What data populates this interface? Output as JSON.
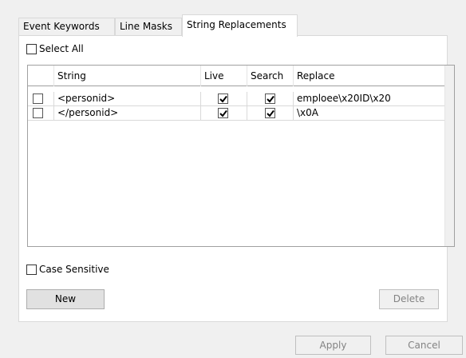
{
  "tabs": [
    {
      "label": "Event Keywords"
    },
    {
      "label": "Line Masks"
    },
    {
      "label": "String Replacements"
    }
  ],
  "select_all": {
    "label": "Select All",
    "checked": false
  },
  "grid": {
    "columns": [
      "",
      "String",
      "Live",
      "Search",
      "Replace"
    ],
    "rows": [
      {
        "selected": false,
        "string": "<personid>",
        "live": true,
        "search": true,
        "replace": "emploee\\x20ID\\x20"
      },
      {
        "selected": false,
        "string": "</personid>",
        "live": true,
        "search": true,
        "replace": "\\x0A"
      }
    ]
  },
  "case_sensitive": {
    "label": "Case Sensitive",
    "checked": false
  },
  "buttons": {
    "new": "New",
    "delete": "Delete",
    "apply": "Apply",
    "cancel": "Cancel"
  }
}
